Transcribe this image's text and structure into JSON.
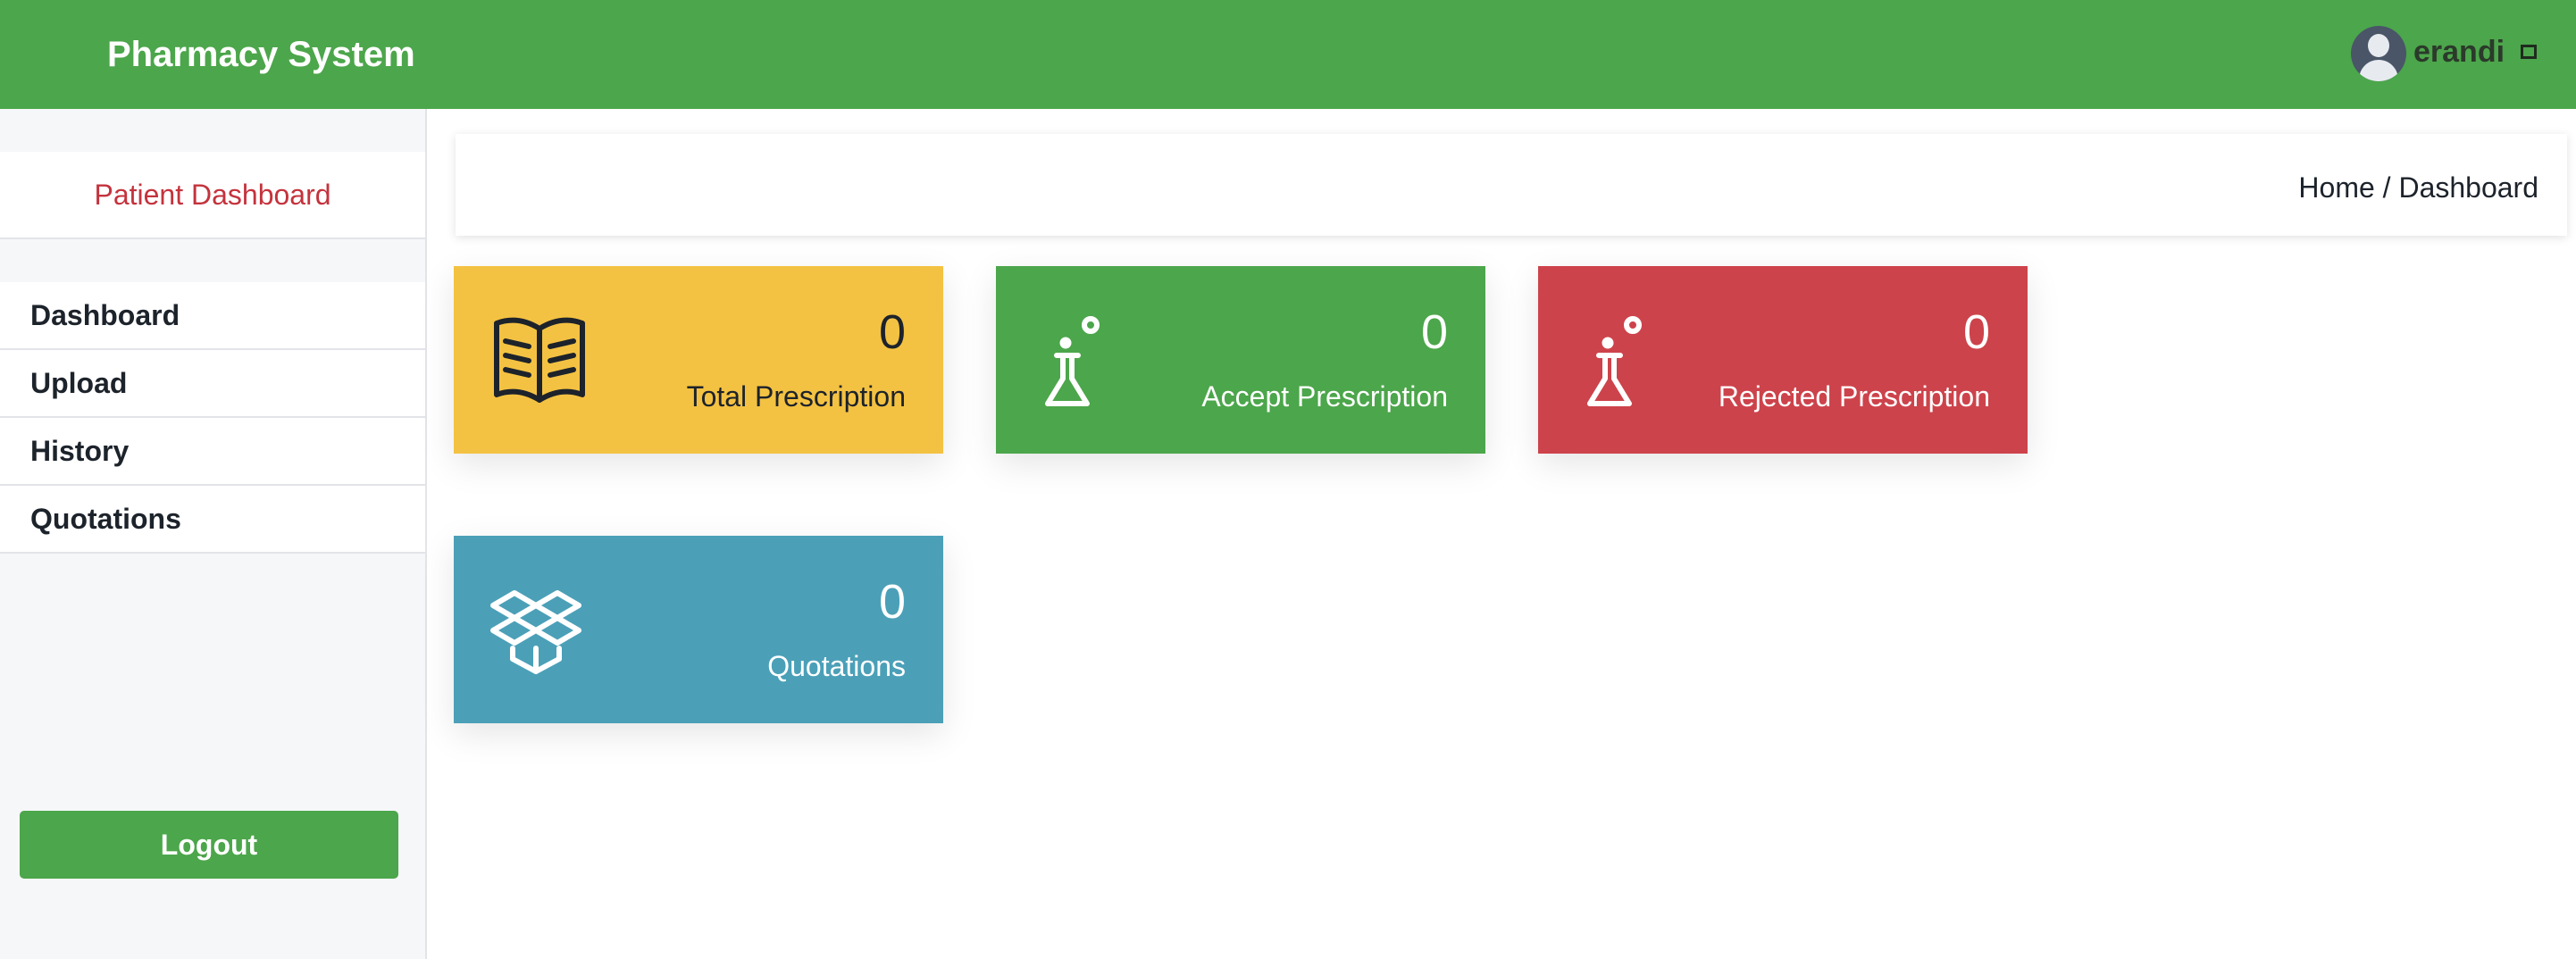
{
  "app": {
    "title": "Pharmacy System"
  },
  "user": {
    "name": "erandi",
    "avatar_icon": "user-avatar-icon",
    "menu_icon": "square-toggle-icon"
  },
  "sidebar": {
    "title": "Patient Dashboard",
    "items": [
      {
        "label": "Dashboard"
      },
      {
        "label": "Upload"
      },
      {
        "label": "History"
      },
      {
        "label": "Quotations"
      }
    ],
    "logout_label": "Logout"
  },
  "breadcrumb": {
    "home": "Home",
    "separator": " / ",
    "current": "Dashboard"
  },
  "cards": [
    {
      "count": "0",
      "label": "Total Prescription",
      "icon": "book-icon",
      "color": "#f4c242",
      "text_color": "#1d232b"
    },
    {
      "count": "0",
      "label": "Accept Prescription",
      "icon": "flask-icon",
      "color": "#4ca64b",
      "text_color": "#ffffff"
    },
    {
      "count": "0",
      "label": "Rejected Prescription",
      "icon": "flask-icon",
      "color": "#cd434b",
      "text_color": "#ffffff"
    },
    {
      "count": "0",
      "label": "Quotations",
      "icon": "dropbox-icon",
      "color": "#4ba0b8",
      "text_color": "#ffffff"
    }
  ],
  "colors": {
    "header": "#4ca64b",
    "sidebar_title": "#c4333d",
    "logout_button": "#4ca64b"
  }
}
